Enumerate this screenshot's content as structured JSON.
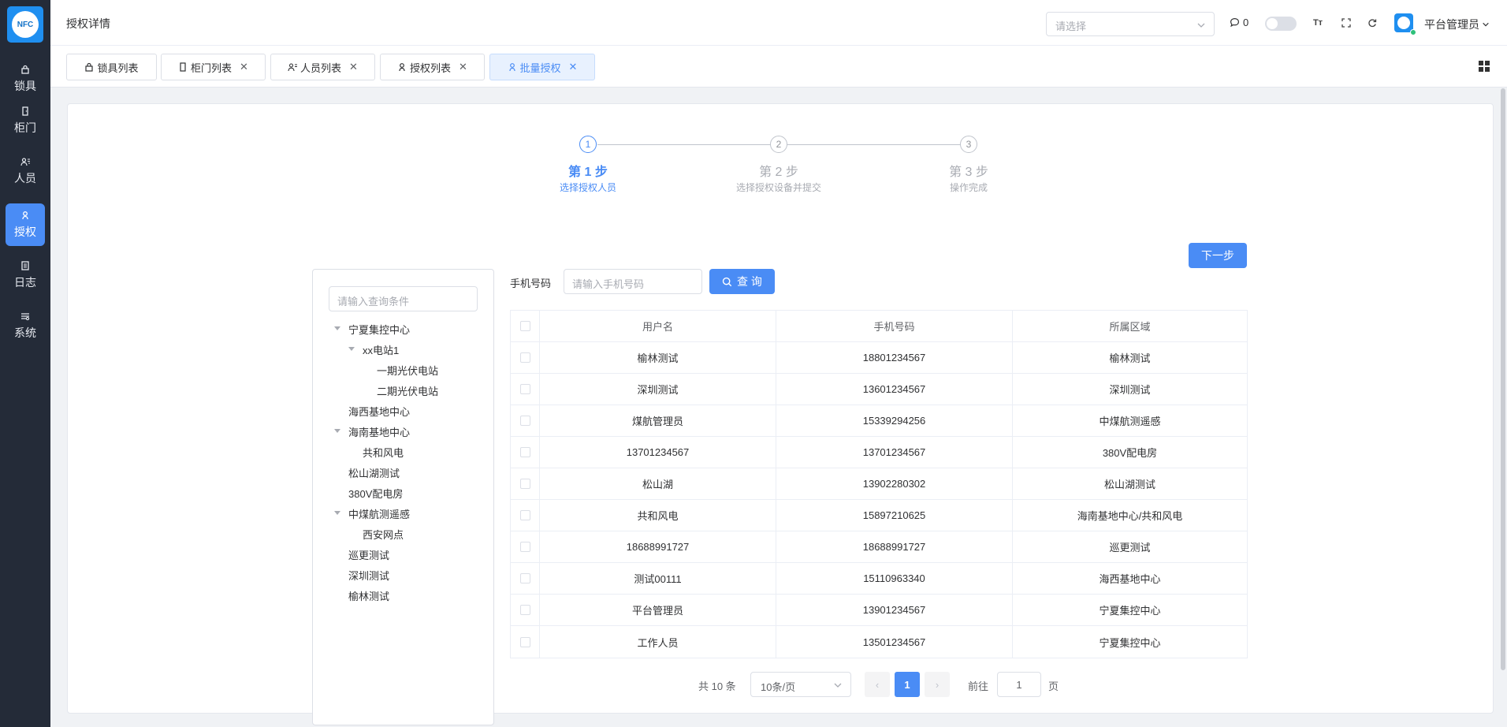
{
  "app": {
    "logo_text": "NFC"
  },
  "sidebar": {
    "items": [
      {
        "label": "锁具",
        "icon": "lock-icon"
      },
      {
        "label": "柜门",
        "icon": "door-icon"
      },
      {
        "label": "人员",
        "icon": "users-icon"
      },
      {
        "label": "授权",
        "icon": "key-icon",
        "active": true
      },
      {
        "label": "日志",
        "icon": "log-icon"
      },
      {
        "label": "系统",
        "icon": "settings-icon"
      }
    ]
  },
  "header": {
    "title": "授权详情",
    "select_placeholder": "请选择",
    "message_count": "0",
    "user_name": "平台管理员"
  },
  "tabs": [
    {
      "label": "锁具列表",
      "icon": "lock-icon",
      "closable": false
    },
    {
      "label": "柜门列表",
      "icon": "door-icon",
      "closable": true
    },
    {
      "label": "人员列表",
      "icon": "users-icon",
      "closable": true
    },
    {
      "label": "授权列表",
      "icon": "key-icon",
      "closable": true
    },
    {
      "label": "批量授权",
      "icon": "key-icon",
      "closable": true,
      "active": true
    }
  ],
  "steps": [
    {
      "number": "1",
      "title": "第 1 步",
      "desc": "选择授权人员",
      "active": true
    },
    {
      "number": "2",
      "title": "第 2 步",
      "desc": "选择授权设备并提交",
      "active": false
    },
    {
      "number": "3",
      "title": "第 3 步",
      "desc": "操作完成",
      "active": false
    }
  ],
  "next_button": "下一步",
  "tree": {
    "search_placeholder": "请输入查询条件",
    "nodes": [
      {
        "label": "宁夏集控中心",
        "level": 0,
        "expanded": true
      },
      {
        "label": "xx电站1",
        "level": 1,
        "expanded": true
      },
      {
        "label": "一期光伏电站",
        "level": 2
      },
      {
        "label": "二期光伏电站",
        "level": 2
      },
      {
        "label": "海西基地中心",
        "level": 0
      },
      {
        "label": "海南基地中心",
        "level": 0,
        "expanded": true
      },
      {
        "label": "共和风电",
        "level": 1
      },
      {
        "label": "松山湖测试",
        "level": 0
      },
      {
        "label": "380V配电房",
        "level": 0
      },
      {
        "label": "中煤航测遥感",
        "level": 0,
        "expanded": true
      },
      {
        "label": "西安网点",
        "level": 1
      },
      {
        "label": "巡更测试",
        "level": 0
      },
      {
        "label": "深圳测试",
        "level": 0
      },
      {
        "label": "榆林测试",
        "level": 0
      }
    ]
  },
  "search": {
    "label": "手机号码",
    "placeholder": "请输入手机号码",
    "button": "查 询"
  },
  "table": {
    "columns": [
      "用户名",
      "手机号码",
      "所属区域"
    ],
    "rows": [
      [
        "榆林测试",
        "18801234567",
        "榆林测试"
      ],
      [
        "深圳测试",
        "13601234567",
        "深圳测试"
      ],
      [
        "煤航管理员",
        "15339294256",
        "中煤航测遥感"
      ],
      [
        "13701234567",
        "13701234567",
        "380V配电房"
      ],
      [
        "松山湖",
        "13902280302",
        "松山湖测试"
      ],
      [
        "共和风电",
        "15897210625",
        "海南基地中心/共和风电"
      ],
      [
        "18688991727",
        "18688991727",
        "巡更测试"
      ],
      [
        "测试00111",
        "15110963340",
        "海西基地中心"
      ],
      [
        "平台管理员",
        "13901234567",
        "宁夏集控中心"
      ],
      [
        "工作人员",
        "13501234567",
        "宁夏集控中心"
      ]
    ]
  },
  "pagination": {
    "total": "共 10 条",
    "page_size": "10条/页",
    "current": "1",
    "goto_label": "前往",
    "goto_value": "1",
    "page_suffix": "页"
  }
}
